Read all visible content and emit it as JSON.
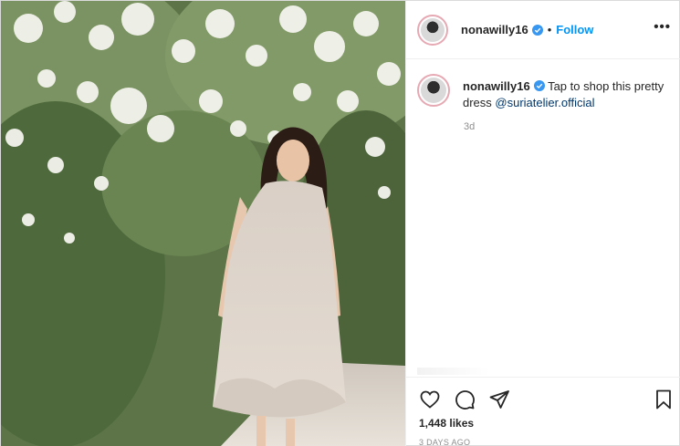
{
  "post": {
    "photo_alt": "photo",
    "header": {
      "username": "nonawilly16",
      "separator": "•",
      "follow_label": "Follow",
      "more_label": "•••"
    },
    "caption": {
      "username": "nonawilly16",
      "text": " Tap to shop this pretty dress ",
      "mention": "@suriatelier.official",
      "time": "3d"
    },
    "likes": "1,448 likes",
    "time_ago": "3 DAYS AGO",
    "icons": {
      "like": "heart-icon",
      "comment": "comment-icon",
      "share": "paper-plane-icon",
      "save": "bookmark-icon",
      "verified": "verified-badge-icon"
    },
    "colors": {
      "follow": "#0095f6",
      "verified": "#3897f0",
      "mention": "#00376b",
      "muted": "#8e8e8e"
    }
  }
}
